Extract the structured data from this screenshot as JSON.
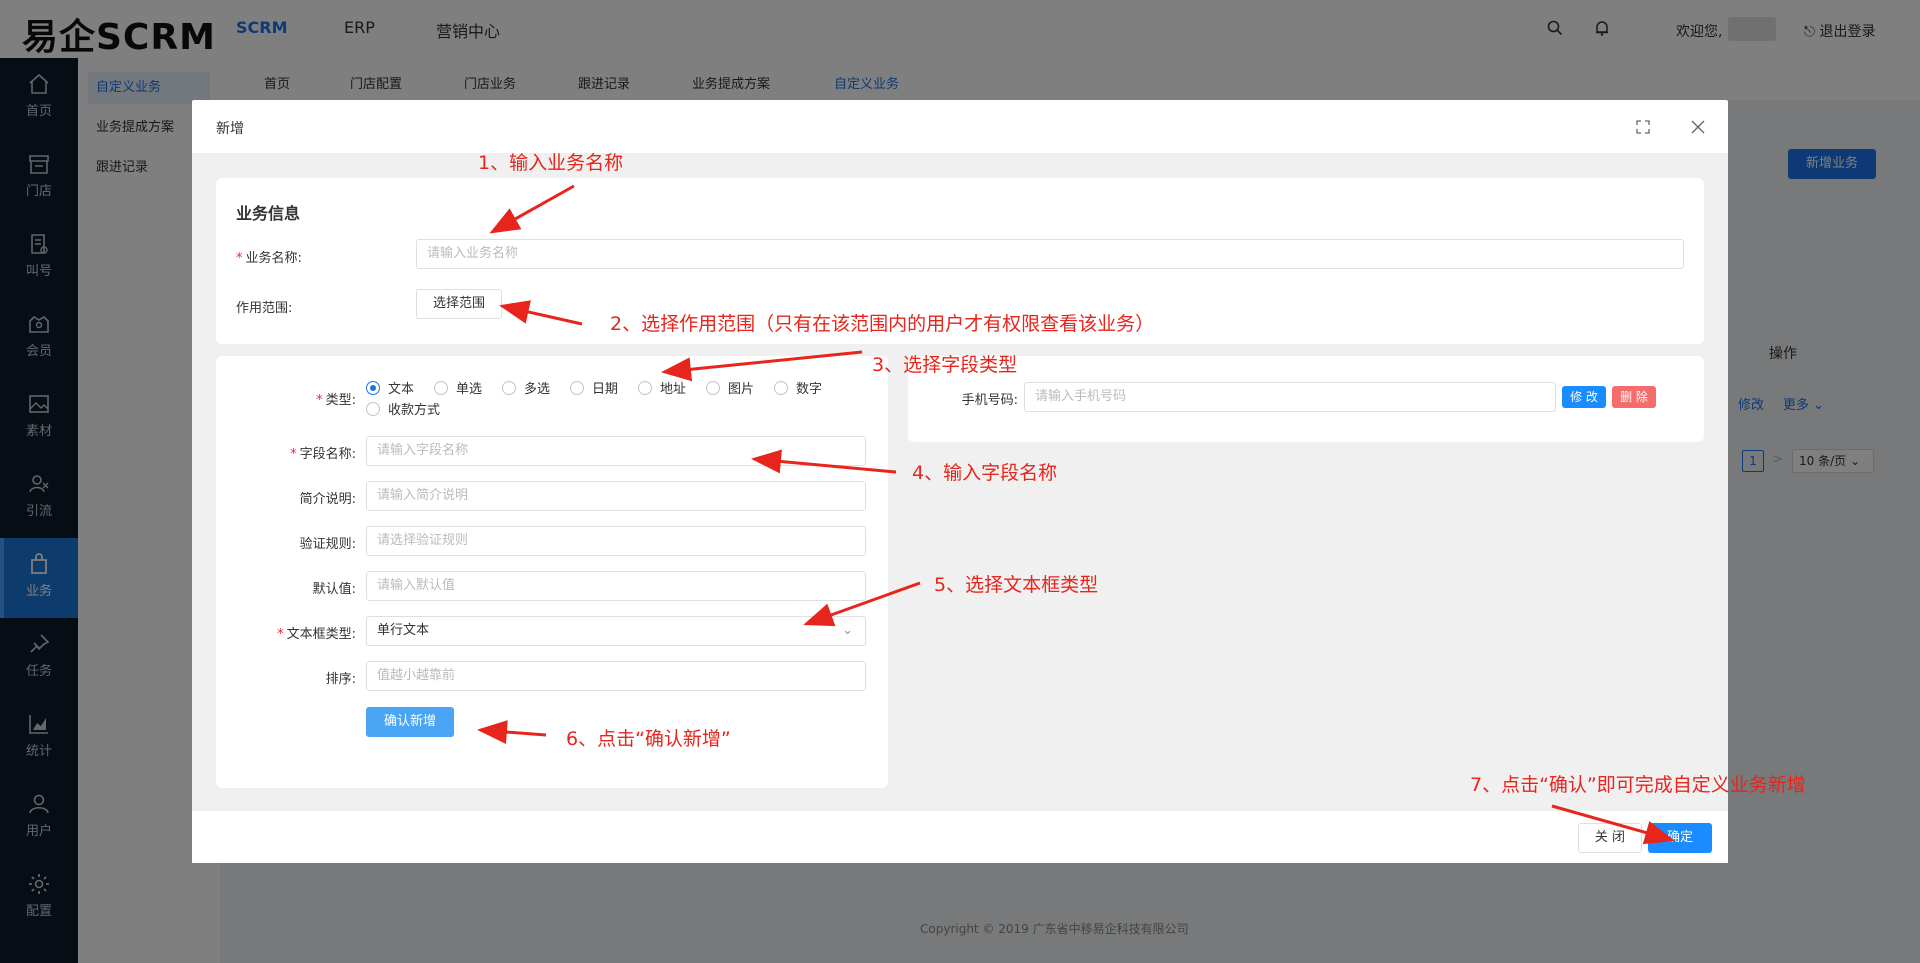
{
  "header": {
    "logo": "易企SCRM",
    "nav": [
      "SCRM",
      "ERP",
      "营销中心"
    ],
    "welcome": "欢迎您,",
    "logout": "退出登录"
  },
  "sidebar": {
    "items": [
      {
        "label": "首页",
        "icon": "home-icon"
      },
      {
        "label": "门店",
        "icon": "store-icon"
      },
      {
        "label": "叫号",
        "icon": "queue-icon"
      },
      {
        "label": "会员",
        "icon": "member-icon"
      },
      {
        "label": "素材",
        "icon": "image-icon"
      },
      {
        "label": "引流",
        "icon": "traffic-icon"
      },
      {
        "label": "业务",
        "icon": "bag-icon"
      },
      {
        "label": "任务",
        "icon": "pin-icon"
      },
      {
        "label": "统计",
        "icon": "chart-icon"
      },
      {
        "label": "用户",
        "icon": "user-icon"
      },
      {
        "label": "配置",
        "icon": "gear-icon"
      }
    ]
  },
  "submenu": [
    "自定义业务",
    "业务提成方案",
    "跟进记录"
  ],
  "tabs": [
    "首页",
    "门店配置",
    "门店业务",
    "跟进记录",
    "业务提成方案",
    "自定义业务"
  ],
  "page": {
    "new_button": "新增业务",
    "op_header": "操作",
    "op_edit": "修改",
    "op_more": "更多",
    "page_num": "1",
    "page_size": "10 条/页",
    "copyright": "Copyright © 2019 广东省中移易企科技有限公司"
  },
  "dialog": {
    "title": "新增",
    "section_title": "业务信息",
    "biz_name_label": "业务名称:",
    "biz_name_placeholder": "请输入业务名称",
    "scope_label": "作用范围:",
    "scope_button": "选择范围",
    "type_label": "类型:",
    "types": [
      "文本",
      "单选",
      "多选",
      "日期",
      "地址",
      "图片",
      "数字",
      "收款方式"
    ],
    "field_name_label": "字段名称:",
    "field_name_placeholder": "请输入字段名称",
    "desc_label": "简介说明:",
    "desc_placeholder": "请输入简介说明",
    "rule_label": "验证规则:",
    "rule_placeholder": "请选择验证规则",
    "default_label": "默认值:",
    "default_placeholder": "请输入默认值",
    "textbox_type_label": "文本框类型:",
    "textbox_type_value": "单行文本",
    "sort_label": "排序:",
    "sort_placeholder": "值越小越靠前",
    "confirm_add": "确认新增",
    "phone_label": "手机号码:",
    "phone_placeholder": "请输入手机号码",
    "edit_btn": "修 改",
    "delete_btn": "删 除",
    "close_btn": "关 闭",
    "ok_btn": "确定"
  },
  "annotations": [
    "1、输入业务名称",
    "2、选择作用范围（只有在该范围内的用户才有权限查看该业务）",
    "3、选择字段类型",
    "4、输入字段名称",
    "5、选择文本框类型",
    "6、点击“确认新增”",
    "7、点击“确认”即可完成自定义业务新增"
  ],
  "colors": {
    "primary": "#1a73e8",
    "sidebar_bg": "#0f1a2b",
    "annotation": "#e8251c",
    "danger": "#f56c6c"
  }
}
